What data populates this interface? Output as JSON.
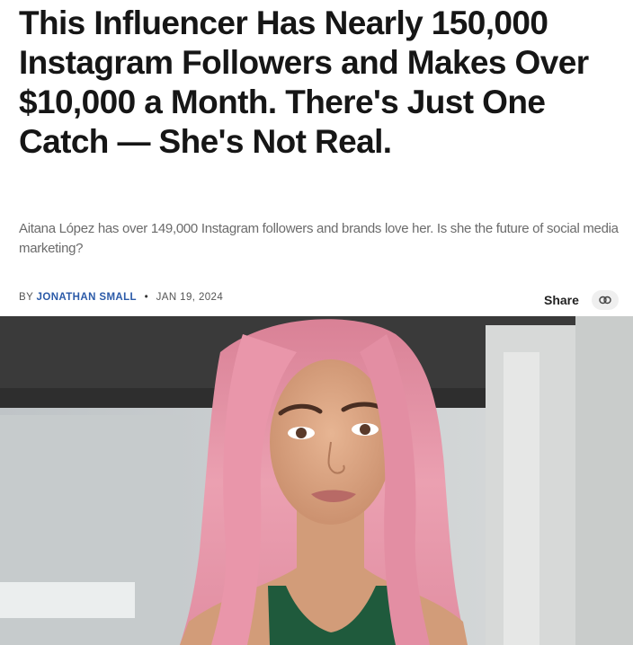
{
  "article": {
    "headline": "This Influencer Has Nearly 150,000 Instagram Followers and Makes Over $10,000 a Month. There's Just One Catch — She's Not Real.",
    "subheadline": "Aitana López has over 149,000 Instagram followers and brands love her. Is she the future of social media marketing?",
    "byline_prefix": "BY",
    "author": "JONATHAN SMALL",
    "separator": "•",
    "date": "JAN 19, 2024",
    "share_label": "Share"
  },
  "icons": {
    "share": "link-icon"
  },
  "colors": {
    "author_link": "#2b5aa8",
    "hair": "#e58fa3",
    "top": "#1f5a3c"
  }
}
